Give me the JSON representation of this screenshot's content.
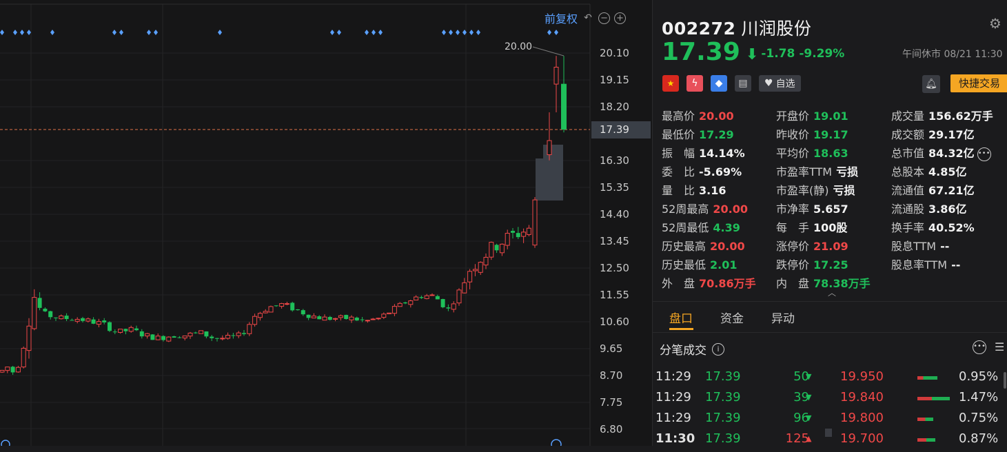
{
  "chart": {
    "toolbar_label": "前复权",
    "peak_label": "20.00",
    "current_price_tag": "17.39",
    "y_axis_ticks": [
      "20.10",
      "19.15",
      "18.20",
      "16.30",
      "15.35",
      "14.40",
      "13.45",
      "12.50",
      "11.55",
      "10.60",
      "9.65",
      "8.70",
      "7.75",
      "6.80"
    ],
    "up_color": "#f04848",
    "down_color": "#1fbf5a",
    "dividend_marker_color": "#5aa0ff"
  },
  "quote": {
    "code": "002272",
    "name": "川润股份",
    "price": "17.39",
    "change": "-1.78",
    "change_pct": "-9.29%",
    "status": "午间休市 08/21 11:30",
    "watch_label": "自选",
    "quick_trade_label": "快捷交易"
  },
  "stats": {
    "c1": [
      {
        "label": "最高价",
        "value": "20.00"
      },
      {
        "label": "最低价",
        "value": "17.29"
      },
      {
        "label": "振　幅",
        "value": "14.14%"
      },
      {
        "label": "委　比",
        "value": "-5.69%"
      },
      {
        "label": "量　比",
        "value": "3.16"
      },
      {
        "label": "52周最高",
        "value": "20.00"
      },
      {
        "label": "52周最低",
        "value": "4.39"
      },
      {
        "label": "历史最高",
        "value": "20.00"
      },
      {
        "label": "历史最低",
        "value": "2.01"
      },
      {
        "label": "外　盘",
        "value": "70.86万手"
      }
    ],
    "c2": [
      {
        "label": "开盘价",
        "value": "19.01"
      },
      {
        "label": "昨收价",
        "value": "19.17"
      },
      {
        "label": "平均价",
        "value": "18.63"
      },
      {
        "label": "市盈率TTM",
        "value": "亏损"
      },
      {
        "label": "市盈率(静)",
        "value": "亏损"
      },
      {
        "label": "市净率",
        "value": "5.657"
      },
      {
        "label": "每　手",
        "value": "100股"
      },
      {
        "label": "涨停价",
        "value": "21.09"
      },
      {
        "label": "跌停价",
        "value": "17.25"
      },
      {
        "label": "内　盘",
        "value": "78.38万手"
      }
    ],
    "c3": [
      {
        "label": "成交量",
        "value": "156.62万手"
      },
      {
        "label": "成交额",
        "value": "29.17亿"
      },
      {
        "label": "总市值",
        "value": "84.32亿"
      },
      {
        "label": "总股本",
        "value": "4.85亿"
      },
      {
        "label": "流通值",
        "value": "67.21亿"
      },
      {
        "label": "流通股",
        "value": "3.86亿"
      },
      {
        "label": "换手率",
        "value": "40.52%"
      },
      {
        "label": "股息TTM",
        "value": "--"
      },
      {
        "label": "股息率TTM",
        "value": "--"
      }
    ]
  },
  "tabs": [
    "盘口",
    "资金",
    "异动"
  ],
  "trades": {
    "title": "分笔成交",
    "rows": [
      {
        "time": "11:29",
        "price": "17.39",
        "volume": "50",
        "dir": "down",
        "level_price": "19.950",
        "pct": "0.95%",
        "red_frac": 0.3,
        "green_frac": 0.7,
        "bar_len": 0.55
      },
      {
        "time": "11:29",
        "price": "17.39",
        "volume": "39",
        "dir": "down",
        "level_price": "19.840",
        "pct": "1.47%",
        "red_frac": 0.45,
        "green_frac": 0.55,
        "bar_len": 0.9
      },
      {
        "time": "11:29",
        "price": "17.39",
        "volume": "96",
        "dir": "down",
        "level_price": "19.800",
        "pct": "0.75%",
        "red_frac": 0.5,
        "green_frac": 0.5,
        "bar_len": 0.45
      },
      {
        "time": "11:30",
        "price": "17.39",
        "volume": "125",
        "dir": "up",
        "level_price": "19.700",
        "pct": "0.87%",
        "red_frac": 0.5,
        "green_frac": 0.5,
        "bar_len": 0.5
      }
    ]
  }
}
